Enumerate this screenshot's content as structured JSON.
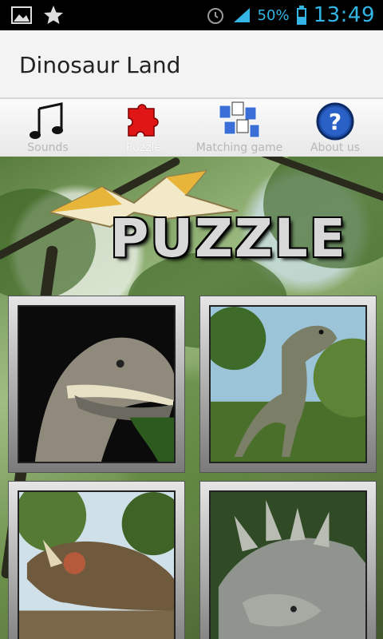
{
  "status_bar": {
    "battery": "50%",
    "time": "13:49"
  },
  "app": {
    "title": "Dinosaur Land"
  },
  "tabs": [
    {
      "label": "Sounds",
      "icon": "music-note-icon"
    },
    {
      "label": "Puzzle",
      "icon": "puzzle-piece-icon"
    },
    {
      "label": "Matching game",
      "icon": "cards-icon"
    },
    {
      "label": "About us",
      "icon": "question-icon"
    }
  ],
  "active_tab": "Puzzle",
  "banner": {
    "title": "PUZZLE"
  },
  "puzzles": [
    {
      "name": "t-rex-puzzle"
    },
    {
      "name": "allosaurus-puzzle"
    },
    {
      "name": "triceratops-puzzle"
    },
    {
      "name": "stegosaurus-puzzle"
    }
  ],
  "colors": {
    "status_accent": "#33b5e5",
    "action_bar_bg": "#f3f3f3",
    "tab_label": "#b7b7b7"
  }
}
